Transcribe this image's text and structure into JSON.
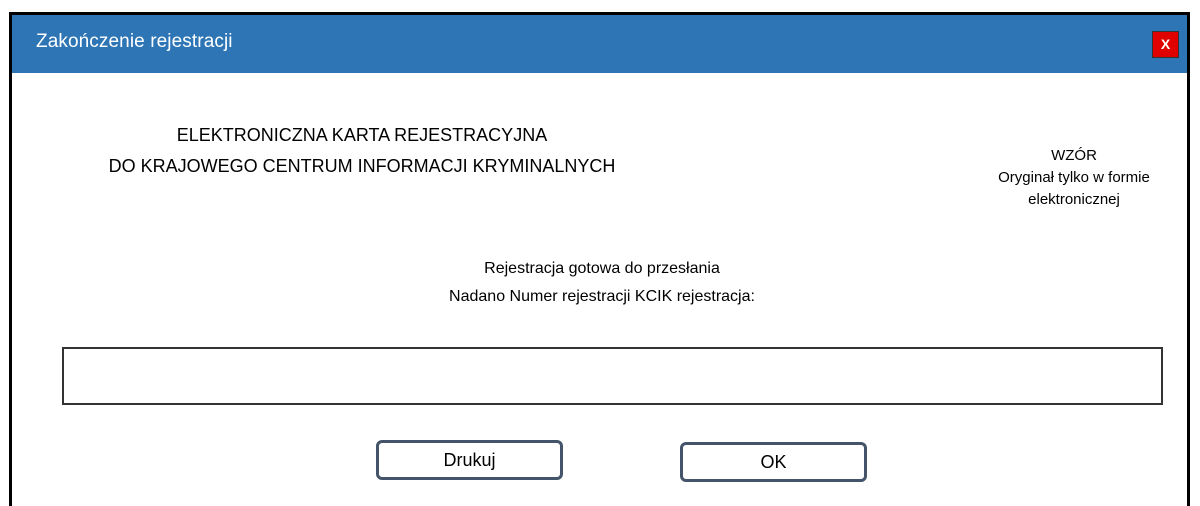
{
  "window": {
    "title": "Zakończenie rejestracji",
    "close_label": "X"
  },
  "card": {
    "title_line1": "ELEKTRONICZNA KARTA REJESTRACYJNA",
    "title_line2": "DO KRAJOWEGO CENTRUM INFORMACJI KRYMINALNYCH"
  },
  "watermark": {
    "line1": "WZÓR",
    "line2": "Oryginał tylko w formie",
    "line3": "elektronicznej"
  },
  "status": {
    "line1": "Rejestracja gotowa do przesłania",
    "line2": "Nadano Numer rejestracji KCIK rejestracja:"
  },
  "registration_number": {
    "value": "",
    "placeholder": ""
  },
  "buttons": {
    "print_label": "Drukuj",
    "ok_label": "OK"
  },
  "colors": {
    "titlebar": "#2e75b6",
    "close": "#e00000",
    "button_border": "#44546a"
  }
}
